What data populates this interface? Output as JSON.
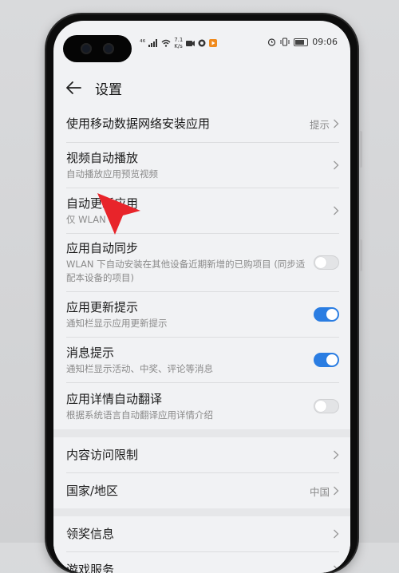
{
  "status_bar": {
    "network": "⁴⁶",
    "speed": "7.1",
    "speed_unit": "K/s",
    "time": "09:06"
  },
  "header": {
    "title": "设置"
  },
  "settings": {
    "item0": {
      "label": "使用移动数据网络安装应用",
      "value": "提示"
    },
    "item1": {
      "label": "视频自动播放",
      "sub": "自动播放应用预览视频"
    },
    "item2": {
      "label": "自动更新应用",
      "sub": "仅 WLAN"
    },
    "item3": {
      "label": "应用自动同步",
      "sub": "WLAN 下自动安装在其他设备近期新增的已购项目 (同步适配本设备的项目)",
      "toggle": "off"
    },
    "item4": {
      "label": "应用更新提示",
      "sub": "通知栏显示应用更新提示",
      "toggle": "on"
    },
    "item5": {
      "label": "消息提示",
      "sub": "通知栏显示活动、中奖、评论等消息",
      "toggle": "on"
    },
    "item6": {
      "label": "应用详情自动翻译",
      "sub": "根据系统语言自动翻译应用详情介绍",
      "toggle": "off"
    },
    "item7": {
      "label": "内容访问限制"
    },
    "item8": {
      "label": "国家/地区",
      "value": "中国"
    },
    "item9": {
      "label": "领奖信息"
    },
    "item10": {
      "label": "游戏服务"
    }
  },
  "colors": {
    "accent": "#2a7de2",
    "pointer": "#e8242a",
    "background": "#f1f2f4"
  },
  "icons": [
    "back-arrow-icon",
    "chevron-right-icon",
    "signal-icon",
    "wifi-icon",
    "battery-icon",
    "pointer-arrow-icon"
  ]
}
